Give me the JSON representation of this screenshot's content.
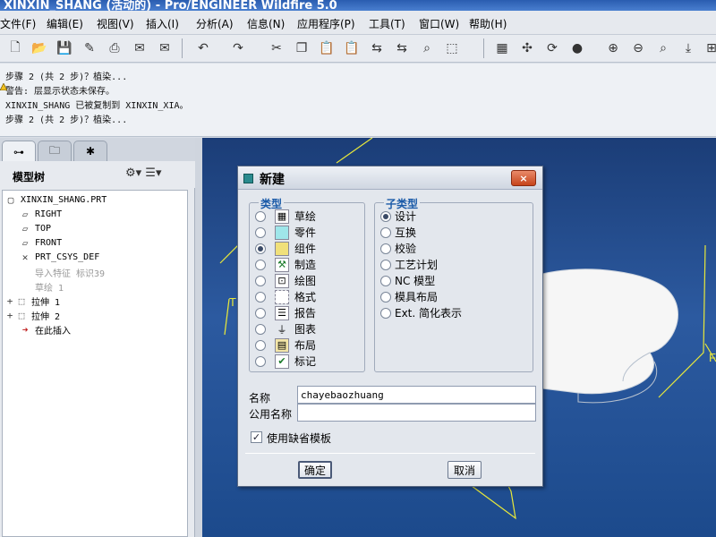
{
  "window": {
    "title": "XINXIN_SHANG (活动的) - Pro/ENGINEER Wildfire 5.0"
  },
  "menu": [
    {
      "label": "文件(F)"
    },
    {
      "label": "编辑(E)"
    },
    {
      "label": "视图(V)"
    },
    {
      "label": "插入(I)"
    },
    {
      "label": "分析(A)"
    },
    {
      "label": "信息(N)"
    },
    {
      "label": "应用程序(P)"
    },
    {
      "label": "工具(T)"
    },
    {
      "label": "窗口(W)"
    },
    {
      "label": "帮助(H)"
    }
  ],
  "messages": [
    "步骤 2 (共 2 步)？植染...",
    "警告: 层显示状态未保存。",
    "XINXIN_SHANG 已被复制到 XINXIN_XIA。",
    "步骤 2 (共 2 步)？植染..."
  ],
  "model_tree": {
    "title": "模型树",
    "items": [
      {
        "label": "XINXIN_SHANG.PRT",
        "icon": "part-icon"
      },
      {
        "label": "RIGHT",
        "icon": "datum-plane-icon"
      },
      {
        "label": "TOP",
        "icon": "datum-plane-icon"
      },
      {
        "label": "FRONT",
        "icon": "datum-plane-icon"
      },
      {
        "label": "PRT_CSYS_DEF",
        "icon": "csys-icon"
      },
      {
        "label": "导入特征 标识39",
        "icon": "import-icon"
      },
      {
        "label": "草绘 1",
        "icon": "sketch-icon"
      },
      {
        "label": "拉伸 1",
        "icon": "extrude-icon"
      },
      {
        "label": "拉伸 2",
        "icon": "extrude-icon"
      },
      {
        "label": "在此插入",
        "icon": "insert-here-arrow-icon"
      }
    ]
  },
  "dialog": {
    "title": "新建",
    "close_label": "×",
    "type_group_label": "类型",
    "types": [
      {
        "label": "草绘",
        "icon": "sketch-icon",
        "selected": false
      },
      {
        "label": "零件",
        "icon": "part-icon",
        "selected": false
      },
      {
        "label": "组件",
        "icon": "assembly-icon",
        "selected": true
      },
      {
        "label": "制造",
        "icon": "manufacturing-icon",
        "selected": false
      },
      {
        "label": "绘图",
        "icon": "drawing-icon",
        "selected": false
      },
      {
        "label": "格式",
        "icon": "format-icon",
        "selected": false
      },
      {
        "label": "报告",
        "icon": "report-icon",
        "selected": false
      },
      {
        "label": "图表",
        "icon": "diagram-icon",
        "selected": false
      },
      {
        "label": "布局",
        "icon": "layout-icon",
        "selected": false
      },
      {
        "label": "标记",
        "icon": "markup-icon",
        "selected": false
      }
    ],
    "subtype_group_label": "子类型",
    "subtypes": [
      {
        "label": "设计",
        "selected": true
      },
      {
        "label": "互换",
        "selected": false
      },
      {
        "label": "校验",
        "selected": false
      },
      {
        "label": "工艺计划",
        "selected": false
      },
      {
        "label": "NC 模型",
        "selected": false
      },
      {
        "label": "模具布局",
        "selected": false
      },
      {
        "label": "Ext. 简化表示",
        "selected": false
      }
    ],
    "name_label": "名称",
    "name_value": "chayebaozhuang",
    "common_name_label": "公用名称",
    "common_name_value": "",
    "use_default_template_label": "使用缺省模板",
    "use_default_template_checked": true,
    "ok_label": "确定",
    "cancel_label": "取消"
  },
  "colors": {
    "graphics_bg": "#2c5aa0",
    "datum_yellow": "#e8e83a",
    "selection_green": "#2a8a8e"
  }
}
